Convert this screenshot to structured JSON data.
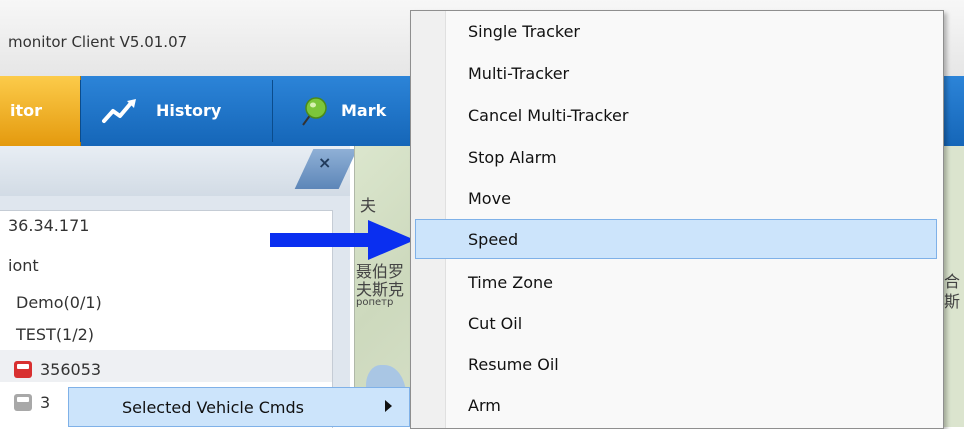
{
  "window": {
    "title": "monitor Client V5.01.07"
  },
  "nav": {
    "monitor_label": "itor",
    "history_label": "History",
    "marker_label": "Mark"
  },
  "panel": {
    "close_glyph": "×"
  },
  "tree": {
    "rows": [
      "36.34.171",
      "iont",
      "Demo(0/1)",
      "TEST(1/2)",
      "356053",
      "3"
    ]
  },
  "map": {
    "labels": [
      "夫",
      "聂伯罗",
      "夫斯克",
      "ропетр",
      "合",
      "斯"
    ]
  },
  "context_menu": {
    "items": [
      "Single Tracker",
      "Multi-Tracker",
      "Cancel Multi-Tracker",
      "Stop Alarm",
      "Move",
      "Speed",
      "Time Zone",
      "Cut Oil",
      " Resume Oil",
      "Arm"
    ],
    "highlighted": "Speed"
  },
  "submenu_trigger": {
    "label": "Selected Vehicle Cmds"
  },
  "colors": {
    "nav_blue": "#1a6fc4",
    "nav_active": "#f0a81c",
    "highlight": "#cce4fb",
    "arrow": "#0a2ff0"
  }
}
